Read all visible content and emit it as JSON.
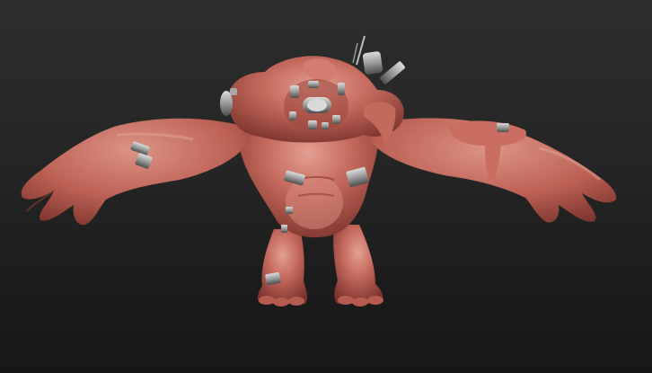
{
  "viewport": {
    "background_top": "#2d2d2d",
    "background_bottom": "#161616"
  },
  "model": {
    "subject": "sculpted-creature",
    "material_color": "#c0655a",
    "material_highlight": "#e09a8c",
    "material_shadow": "#6e2d27",
    "attachment_color": "#a8a8a8",
    "attachment_dark": "#5c5c5c"
  }
}
